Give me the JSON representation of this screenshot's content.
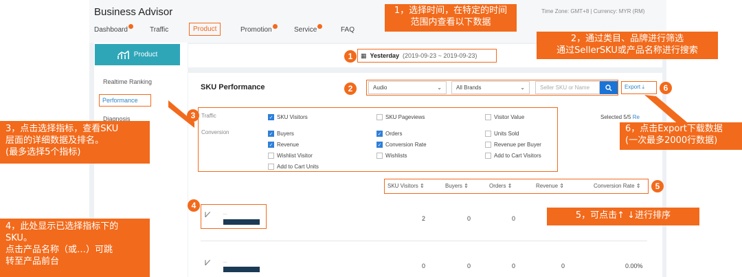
{
  "header": {
    "brand": "Business Advisor",
    "timezone": "Time Zone: GMT+8 | Currency: MYR (RM)",
    "nav": [
      {
        "label": "Dashboard",
        "dot": true
      },
      {
        "label": "Traffic",
        "dot": false
      },
      {
        "label": "Product",
        "dot": false,
        "active": true
      },
      {
        "label": "Promotion",
        "dot": true
      },
      {
        "label": "Service",
        "dot": true
      },
      {
        "label": "FAQ",
        "dot": false
      }
    ]
  },
  "sidebar": {
    "product_label": "Product",
    "items": [
      "Realtime Ranking",
      "Performance",
      "Diagnosis"
    ]
  },
  "date_picker": {
    "label": "Yesterday",
    "range": "(2019-09-23 ~ 2019-09-23)"
  },
  "sku": {
    "title": "SKU Performance",
    "category": "Audio",
    "brand": "All Brands",
    "search_placeholder": "Seller SKU or Name",
    "export_label": "Export",
    "selected_text": "Selected 5/5",
    "reset_label": "Re"
  },
  "metrics": {
    "traffic_label": "Traffic",
    "conversion_label": "Conversion",
    "traffic": [
      {
        "label": "SKU Visitors",
        "checked": true
      },
      {
        "label": "SKU Pageviews",
        "checked": false
      },
      {
        "label": "Visitor Value",
        "checked": false
      }
    ],
    "conversion": [
      {
        "label": "Buyers",
        "checked": true
      },
      {
        "label": "Orders",
        "checked": true
      },
      {
        "label": "Units Sold",
        "checked": false
      },
      {
        "label": "Revenue",
        "checked": true
      },
      {
        "label": "Conversion Rate",
        "checked": true
      },
      {
        "label": "Revenue per Buyer",
        "checked": false
      },
      {
        "label": "Wishlist Visitor",
        "checked": false
      },
      {
        "label": "Wishlists",
        "checked": false
      },
      {
        "label": "Add to Cart Visitors",
        "checked": false
      },
      {
        "label": "Add to Cart Units",
        "checked": false
      }
    ]
  },
  "table": {
    "columns": [
      "SKU Visitors",
      "Buyers",
      "Orders",
      "Revenue",
      "Conversion Rate"
    ],
    "sort_glyph": "⇕",
    "rows": [
      {
        "name": "...",
        "visitors": "2",
        "buyers": "0",
        "orders": "0",
        "revenue": "",
        "conv": ""
      },
      {
        "name": "...",
        "visitors": "0",
        "buyers": "0",
        "orders": "0",
        "revenue": "0",
        "conv": "0.00%"
      }
    ]
  },
  "callouts": {
    "c1": "1，选择时间，在特定的时间范围内查看以下数据",
    "c2_l1": "2，通过类目、品牌进行筛选",
    "c2_l2": "通过SellerSKU或产品名称进行搜索",
    "c3_l1": "3，点击选择指标，查看SKU",
    "c3_l2": "层面的详细数据及排名。",
    "c3_l3": "(最多选择5个指标)",
    "c4_l1": "4，此处显示已选择指标下的",
    "c4_l2": "SKU。",
    "c4_l3": "点击产品名称（或…）可跳",
    "c4_l4": "转至产品前台",
    "c5": "5，可点击↑ ↓进行排序",
    "c6_l1": "6，点击Export下载数据",
    "c6_l2": "(一次最多2000行数据)"
  },
  "numbers": [
    "1",
    "2",
    "3",
    "4",
    "5",
    "6"
  ],
  "colors": {
    "accent": "#f26a1b",
    "brand_teal": "#2fa6b8",
    "link": "#2f86c8",
    "check": "#2e7fd8"
  }
}
